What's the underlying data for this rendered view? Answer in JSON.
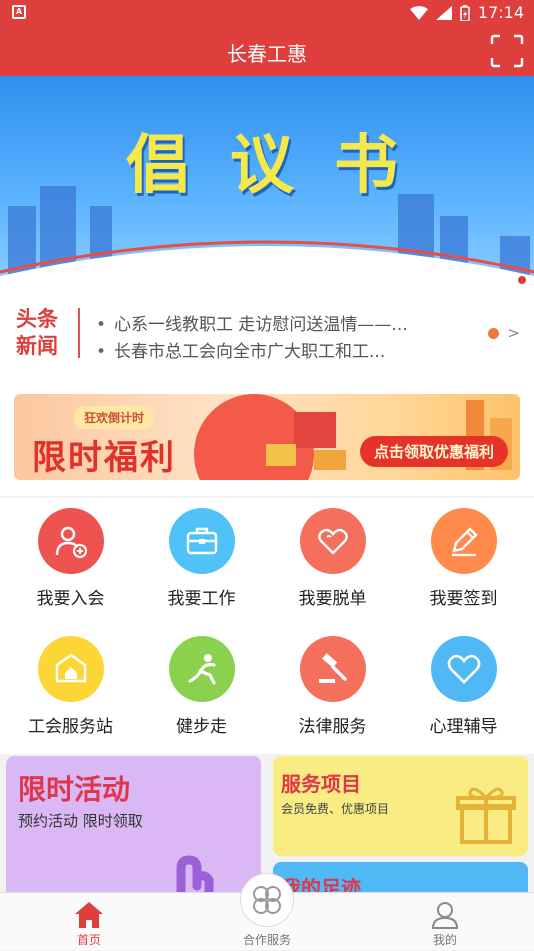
{
  "status_bar": {
    "time": "17:14",
    "left_icon": "A"
  },
  "header": {
    "title": "长春工惠",
    "scan_icon": "scan-icon"
  },
  "banner": {
    "title": "倡议书"
  },
  "news": {
    "tag_line1": "头条",
    "tag_line2": "新闻",
    "items": [
      "心系一线教职工 走访慰问送温情——...",
      "长春市总工会向全市广大职工和工..."
    ],
    "more_symbol": ">"
  },
  "promo": {
    "countdown_badge": "狂欢倒计时",
    "headline": "限时福利",
    "cta": "点击领取优惠福利"
  },
  "services": [
    {
      "label": "我要入会",
      "color": "#ef5350",
      "icon": "add-user-icon"
    },
    {
      "label": "我要工作",
      "color": "#4fc3f7",
      "icon": "briefcase-icon"
    },
    {
      "label": "我要脱单",
      "color": "#f46f5c",
      "icon": "hearts-icon"
    },
    {
      "label": "我要签到",
      "color": "#ff8a4c",
      "icon": "pencil-icon"
    },
    {
      "label": "工会服务站",
      "color": "#fbd636",
      "icon": "home-badge-icon"
    },
    {
      "label": "健步走",
      "color": "#8bd14e",
      "icon": "runner-icon"
    },
    {
      "label": "法律服务",
      "color": "#f46f5c",
      "icon": "gavel-icon"
    },
    {
      "label": "心理辅导",
      "color": "#4fb8f5",
      "icon": "heart-icon"
    }
  ],
  "cards": {
    "activity": {
      "title": "限时活动",
      "subtitle": "预约活动 限时领取"
    },
    "services": {
      "title": "服务项目",
      "subtitle": "会员免费、优惠项目"
    },
    "footprint": {
      "title": "我的足迹"
    }
  },
  "tabbar": {
    "home": "首页",
    "partner": "合作服务",
    "mine": "我的"
  },
  "colors": {
    "brand_red": "#de3f3d",
    "accent_yellow": "#f5e84a"
  }
}
